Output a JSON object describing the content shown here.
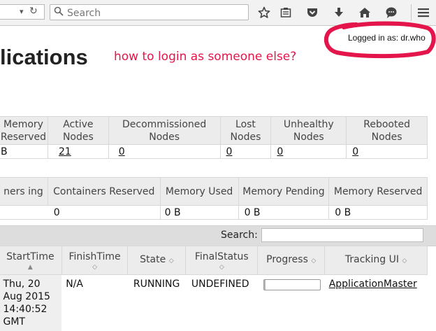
{
  "browser": {
    "search_placeholder": "Search",
    "dropdown_glyph": "▾",
    "reload_glyph": "↻",
    "search_glyph": "⚲",
    "icons": [
      "star-icon",
      "reading-list-icon",
      "pocket-icon",
      "download-icon",
      "home-icon",
      "chat-icon",
      "menu-icon"
    ]
  },
  "page": {
    "title": "lications",
    "annotation": "how to login as someone else?",
    "logged_in": "Logged in as: dr.who",
    "highlight_color": "#e4154a"
  },
  "cluster_metrics": {
    "headers": [
      "Memory Reserved",
      "Active Nodes",
      "Decommissioned Nodes",
      "Lost Nodes",
      "Unhealthy Nodes",
      "Rebooted Nodes"
    ],
    "values": [
      "B",
      "21",
      "0",
      "0",
      "0",
      "0"
    ]
  },
  "scheduler_metrics": {
    "headers": [
      "ners ing",
      "Containers Reserved",
      "Memory Used",
      "Memory Pending",
      "Memory Reserved"
    ],
    "values": [
      "0",
      "0 B",
      "0 B",
      "0 B",
      ""
    ]
  },
  "search": {
    "label": "Search:",
    "value": ""
  },
  "apps": {
    "headers": [
      "StartTime",
      "FinishTime",
      "State",
      "FinalStatus",
      "Progress",
      "Tracking UI"
    ],
    "rows": [
      {
        "start_time": "Thu, 20 Aug 2015 14:40:52 GMT",
        "finish_time": "N/A",
        "state": "RUNNING",
        "final_status": "UNDEFINED",
        "progress": 0.03,
        "tracking_ui": "ApplicationMaster"
      }
    ]
  }
}
